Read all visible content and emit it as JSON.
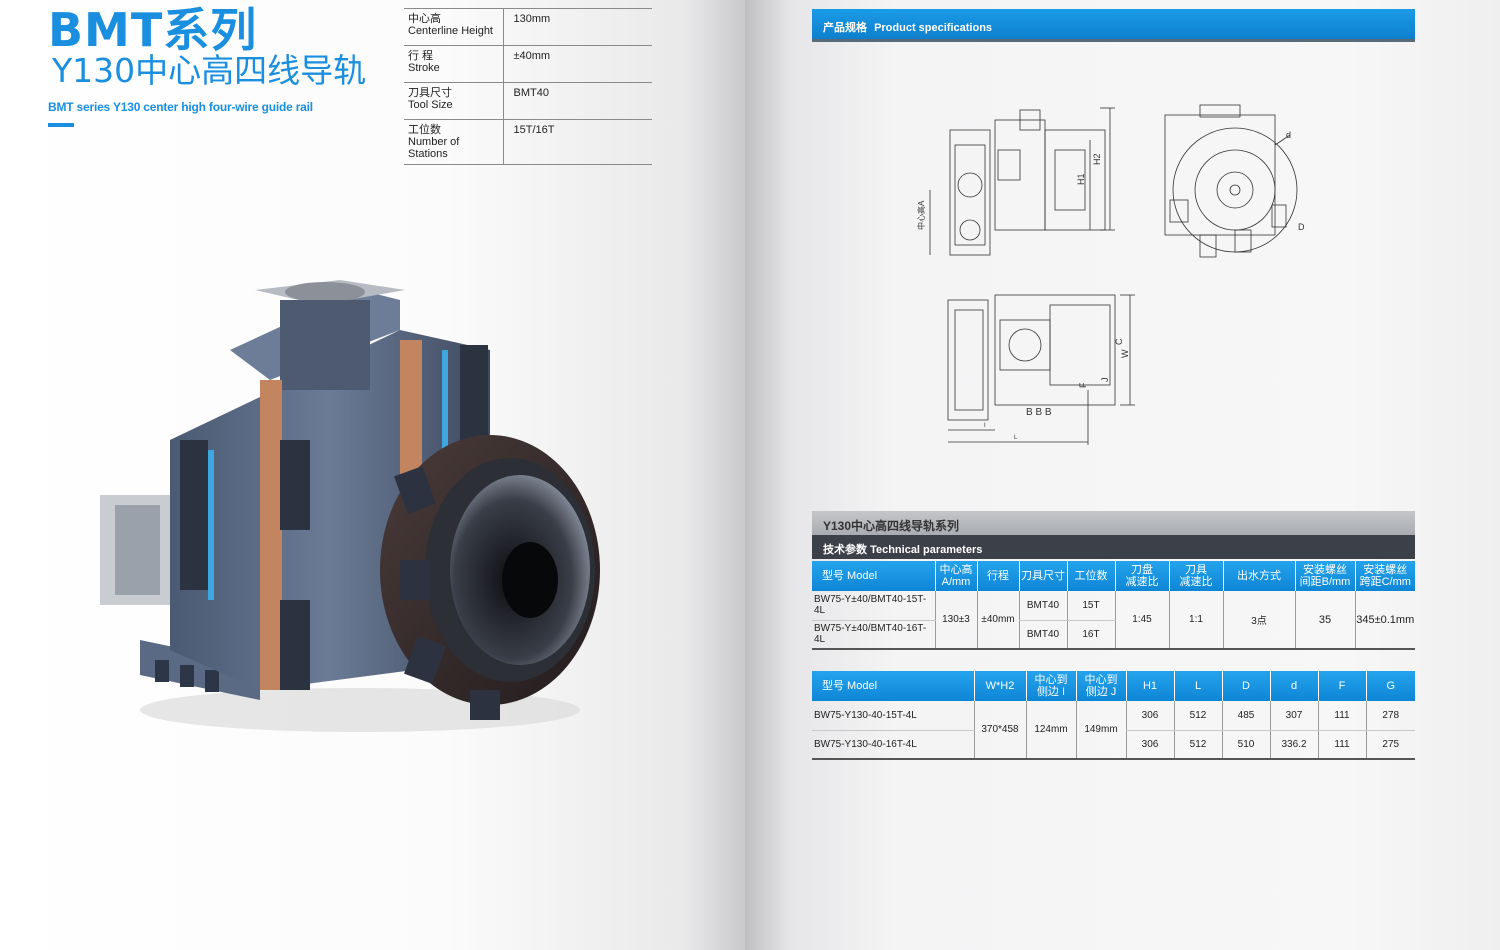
{
  "left": {
    "title_main": "BMT系列",
    "title_sub": "Y130中心高四线导轨",
    "title_en": "BMT series  Y130 center high four-wire guide rail",
    "specs": [
      {
        "cn": "中心高",
        "en": "Centerline Height",
        "value": "130mm"
      },
      {
        "cn": "行  程",
        "en": "Stroke",
        "value": "±40mm"
      },
      {
        "cn": "刀具尺寸",
        "en": "Tool Size",
        "value": "BMT40"
      },
      {
        "cn": "工位数",
        "en": "Number of Stations",
        "value": "15T/16T"
      }
    ]
  },
  "right": {
    "spec_bar_cn": "产品规格",
    "spec_bar_en": "Product specifications",
    "drawing_labels": {
      "center_height": "中心高A",
      "h1": "H1",
      "h2": "H2",
      "d_small": "d",
      "d_big": "D",
      "c": "C",
      "w": "W",
      "f": "F",
      "j": "J",
      "bbb": "B B B",
      "i": "I",
      "l": "L"
    },
    "series_title": "Y130中心高四线导轨系列",
    "tech_cn": "技术参数",
    "tech_en": "Technical parameters",
    "table1": {
      "headers": [
        "型号 Model",
        "中心高\nA/mm",
        "行程",
        "刀具尺寸",
        "工位数",
        "刀盘\n减速比",
        "刀具\n减速比",
        "出水方式",
        "安装螺丝\n间距B/mm",
        "安装螺丝\n跨距C/mm"
      ],
      "rows": [
        {
          "model": "BW75-Y±40/BMT40-15T-4L",
          "tool": "BMT40",
          "stations": "15T"
        },
        {
          "model": "BW75-Y±40/BMT40-16T-4L",
          "tool": "BMT40",
          "stations": "16T"
        }
      ],
      "shared": {
        "center": "130±3",
        "stroke": "±40mm",
        "disc_ratio": "1:45",
        "tool_ratio": "1:1",
        "water": "3点",
        "b": "35",
        "c": "345±0.1mm"
      }
    },
    "table2": {
      "headers": [
        "型号 Model",
        "W*H2",
        "中心到\n侧边 I",
        "中心到\n侧边 J",
        "H1",
        "L",
        "D",
        "d",
        "F",
        "G"
      ],
      "rows": [
        {
          "model": "BW75-Y130-40-15T-4L",
          "h1": "306",
          "l": "512",
          "D": "485",
          "d": "307",
          "f": "111",
          "g": "278"
        },
        {
          "model": "BW75-Y130-40-16T-4L",
          "h1": "306",
          "l": "512",
          "D": "510",
          "d": "336.2",
          "f": "111",
          "g": "275"
        }
      ],
      "shared": {
        "wh2": "370*458",
        "i": "124mm",
        "j": "149mm"
      }
    }
  }
}
